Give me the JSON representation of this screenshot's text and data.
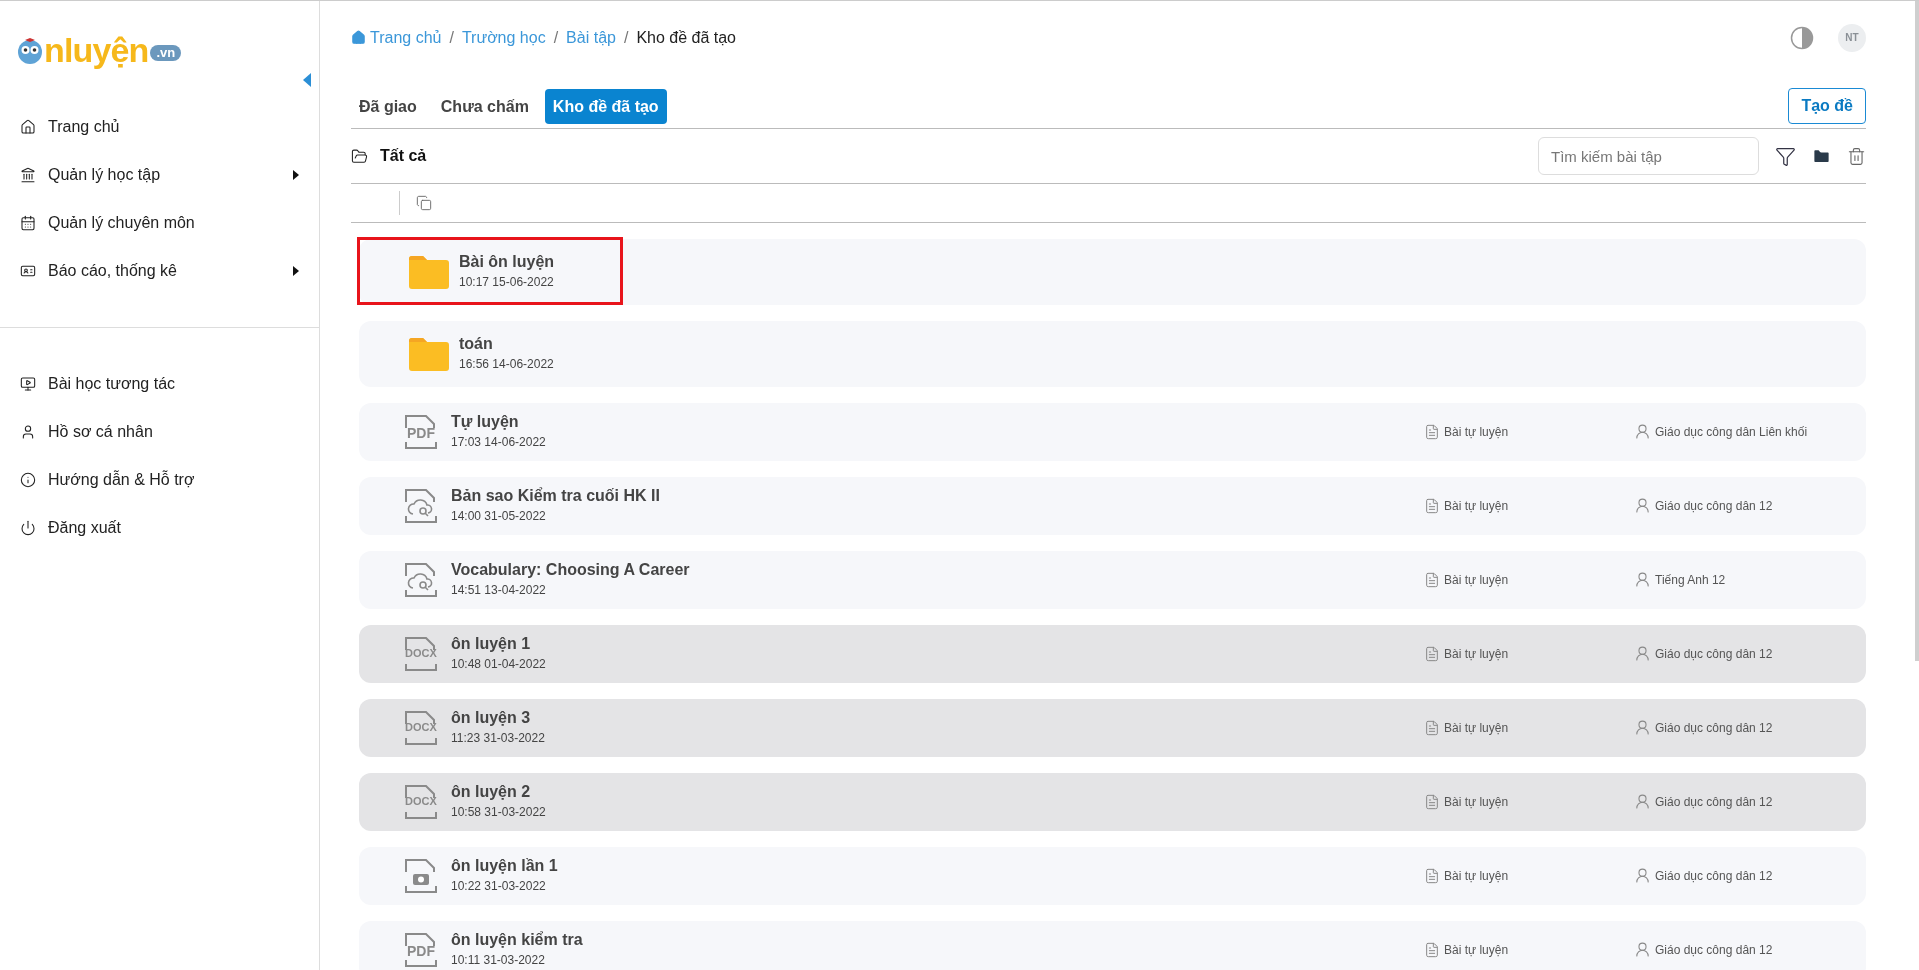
{
  "sidebar": {
    "logo": {
      "main": "nluyện",
      "suffix": ".vn"
    },
    "items": [
      {
        "label": "Trang chủ",
        "has_submenu": false
      },
      {
        "label": "Quản lý học tập",
        "has_submenu": true
      },
      {
        "label": "Quản lý chuyên môn",
        "has_submenu": false
      },
      {
        "label": "Báo cáo, thống kê",
        "has_submenu": true
      }
    ],
    "secondary_items": [
      {
        "label": "Bài học tương tác"
      },
      {
        "label": "Hồ sơ cá nhân"
      },
      {
        "label": "Hướng dẫn & Hỗ trợ"
      },
      {
        "label": "Đăng xuất"
      }
    ]
  },
  "breadcrumb": {
    "separator": "/",
    "items": [
      "Trang chủ",
      "Trường học",
      "Bài tập",
      "Kho đề đã tạo"
    ]
  },
  "avatar": "NT",
  "tabs": [
    {
      "label": "Đã giao",
      "selected": false
    },
    {
      "label": "Chưa chấm",
      "selected": false
    },
    {
      "label": "Kho đề đã tạo",
      "selected": true
    }
  ],
  "create_button": "Tạo đề",
  "folder_label": "Tất cả",
  "search": {
    "placeholder": "Tìm kiếm bài tập"
  },
  "items": [
    {
      "kind": "folder",
      "name": "Bài ôn luyện",
      "time": "10:17 15-06-2022",
      "selected": false,
      "outlined": true
    },
    {
      "kind": "folder",
      "name": "toán",
      "time": "16:56 14-06-2022",
      "selected": false,
      "outlined": false
    },
    {
      "kind": "pdf",
      "badge": "PDF",
      "name": "Tự luyện",
      "time": "17:03 14-06-2022",
      "category": "Bài tự luyện",
      "subject": "Giáo dục công dân Liên khối",
      "selected": false,
      "outlined": false
    },
    {
      "kind": "cloud",
      "name": "Bản sao Kiểm tra cuối HK II",
      "time": "14:00 31-05-2022",
      "category": "Bài tự luyện",
      "subject": "Giáo dục công dân 12",
      "selected": false,
      "outlined": false
    },
    {
      "kind": "cloud",
      "name": "Vocabulary: Choosing A Career",
      "time": "14:51 13-04-2022",
      "category": "Bài tự luyện",
      "subject": "Tiếng Anh 12",
      "selected": false,
      "outlined": false
    },
    {
      "kind": "docx",
      "badge": "DOCX",
      "name": "ôn luyện 1",
      "time": "10:48 01-04-2022",
      "category": "Bài tự luyện",
      "subject": "Giáo dục công dân 12",
      "selected": true,
      "outlined": false
    },
    {
      "kind": "docx",
      "badge": "DOCX",
      "name": "ôn luyện 3",
      "time": "11:23 31-03-2022",
      "category": "Bài tự luyện",
      "subject": "Giáo dục công dân 12",
      "selected": true,
      "outlined": false
    },
    {
      "kind": "docx",
      "badge": "DOCX",
      "name": "ôn luyện 2",
      "time": "10:58 31-03-2022",
      "category": "Bài tự luyện",
      "subject": "Giáo dục công dân 12",
      "selected": true,
      "outlined": false
    },
    {
      "kind": "image",
      "name": "ôn luyện lần 1",
      "time": "10:22 31-03-2022",
      "category": "Bài tự luyện",
      "subject": "Giáo dục công dân 12",
      "selected": false,
      "outlined": false
    },
    {
      "kind": "pdf",
      "badge": "PDF",
      "name": "ôn luyện kiểm tra",
      "time": "10:11 31-03-2022",
      "category": "Bài tự luyện",
      "subject": "Giáo dục công dân 12",
      "selected": false,
      "outlined": false
    }
  ]
}
